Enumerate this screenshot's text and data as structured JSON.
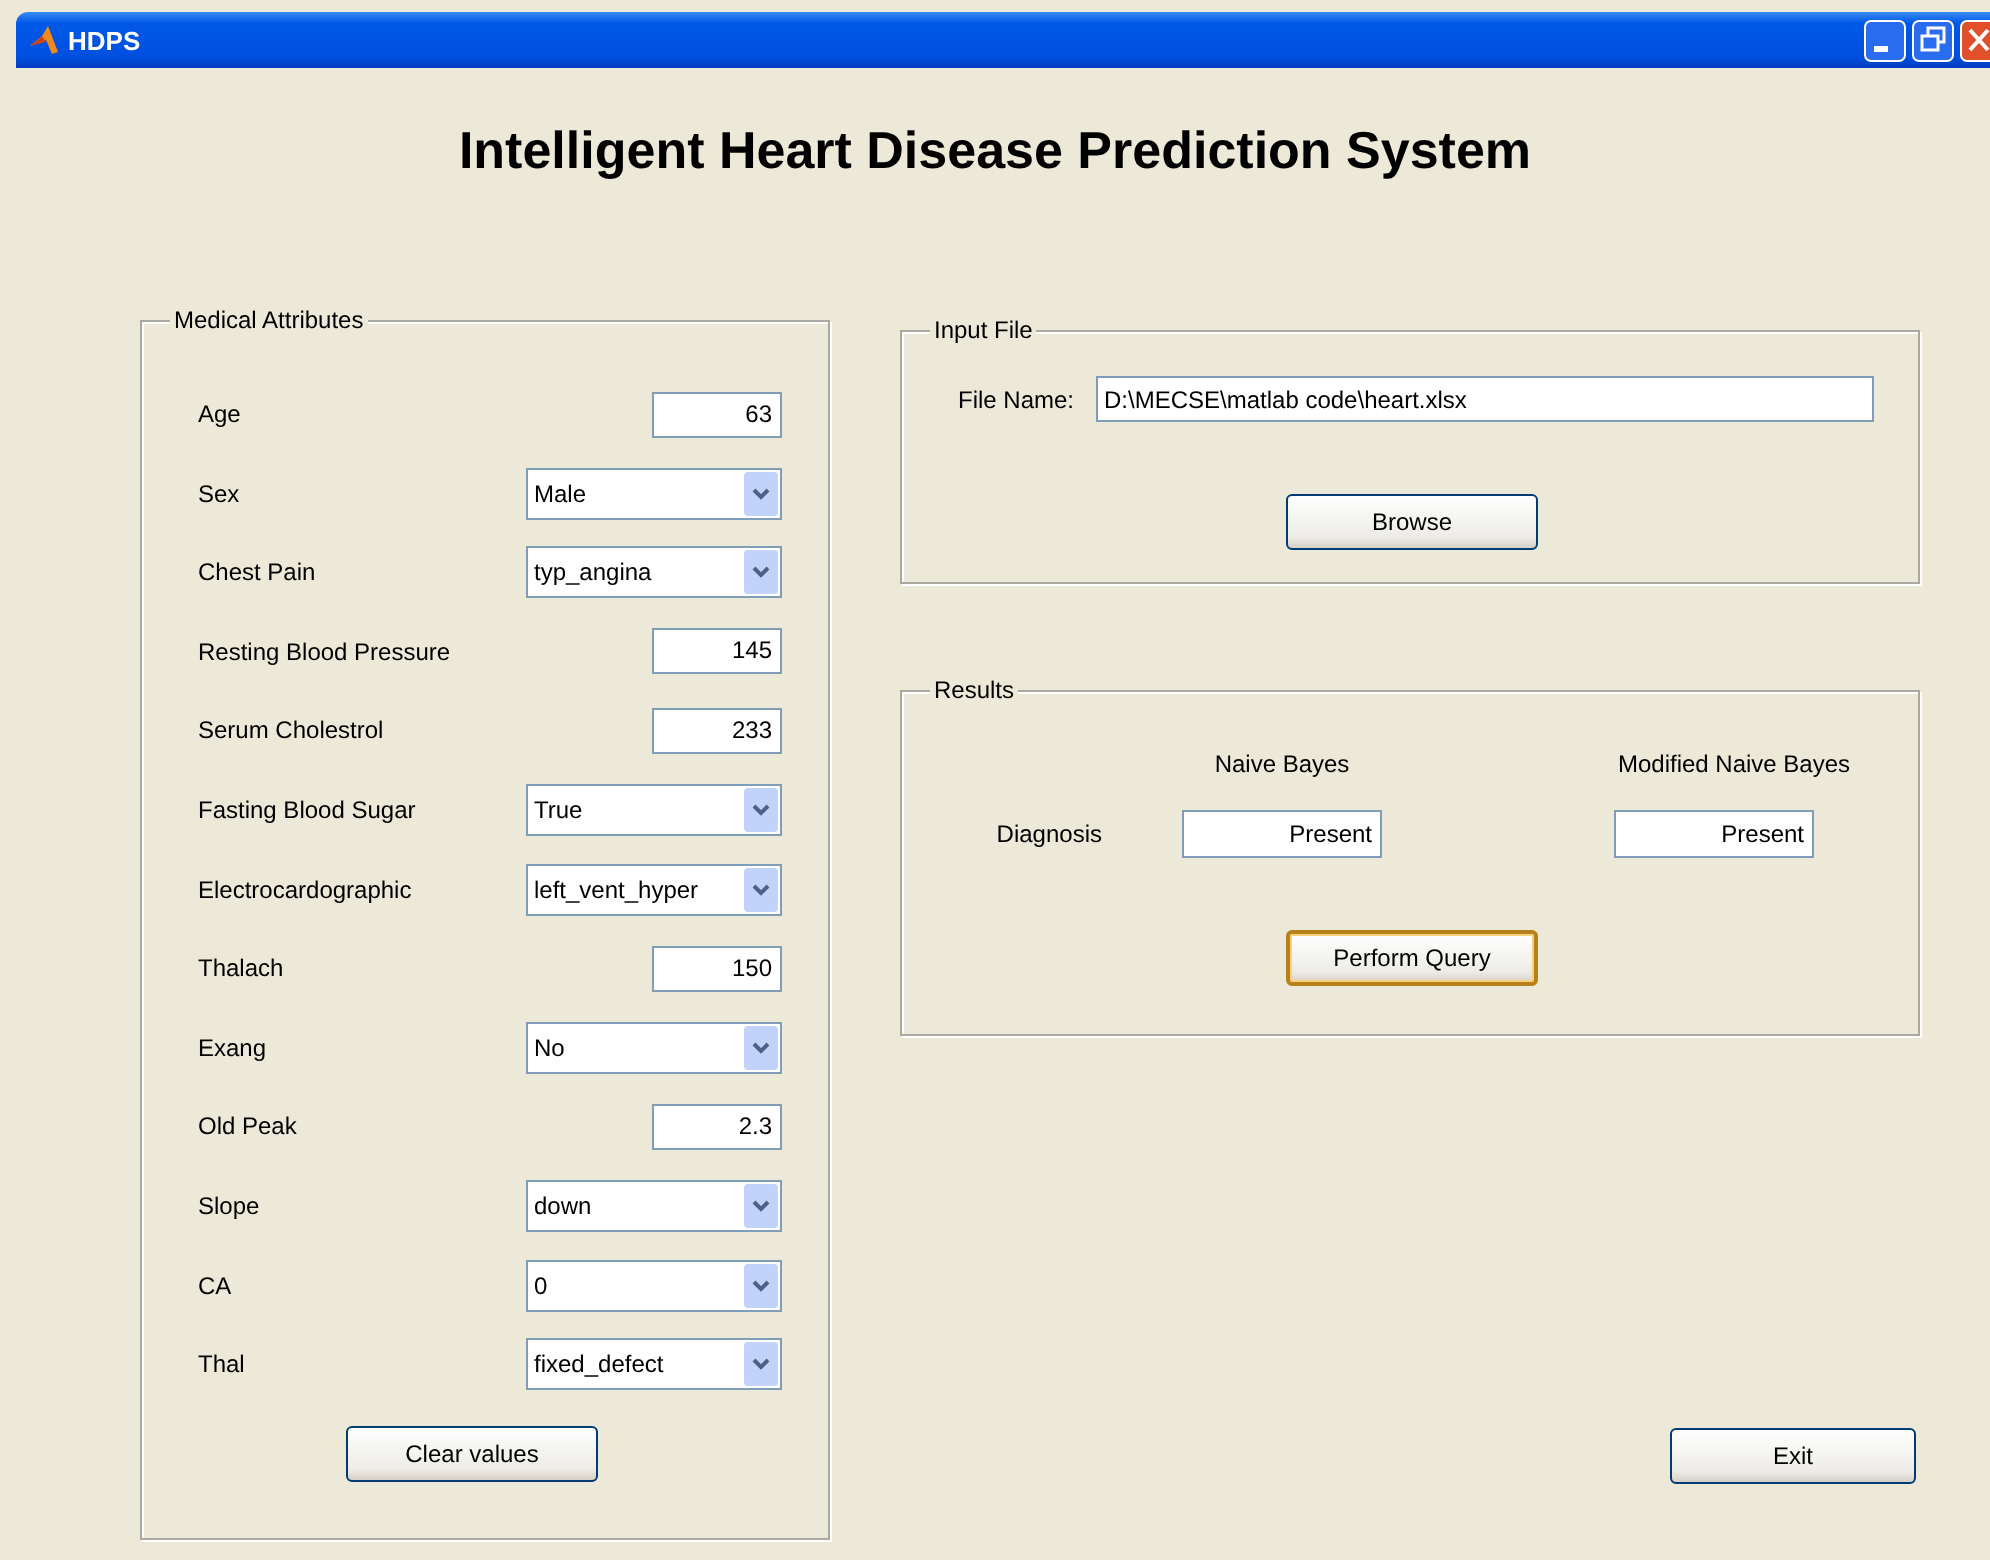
{
  "window": {
    "title": "HDPS"
  },
  "heading": "Intelligent Heart Disease Prediction System",
  "medical_attributes": {
    "legend": "Medical Attributes",
    "fields": [
      {
        "label": "Age",
        "kind": "text",
        "value": "63"
      },
      {
        "label": "Sex",
        "kind": "dropdown",
        "value": "Male"
      },
      {
        "label": "Chest Pain",
        "kind": "dropdown",
        "value": "typ_angina"
      },
      {
        "label": "Resting Blood Pressure",
        "kind": "text",
        "value": "145"
      },
      {
        "label": "Serum Cholestrol",
        "kind": "text",
        "value": "233"
      },
      {
        "label": "Fasting Blood Sugar",
        "kind": "dropdown",
        "value": "True"
      },
      {
        "label": "Electrocardographic",
        "kind": "dropdown",
        "value": "left_vent_hyper"
      },
      {
        "label": "Thalach",
        "kind": "text",
        "value": "150"
      },
      {
        "label": "Exang",
        "kind": "dropdown",
        "value": "No"
      },
      {
        "label": "Old Peak",
        "kind": "text",
        "value": "2.3"
      },
      {
        "label": "Slope",
        "kind": "dropdown",
        "value": "down"
      },
      {
        "label": "CA",
        "kind": "dropdown",
        "value": "0"
      },
      {
        "label": "Thal",
        "kind": "dropdown",
        "value": "fixed_defect"
      }
    ],
    "button": {
      "label": "Clear values",
      "focused": false
    }
  },
  "input_file": {
    "legend": "Input File",
    "file_name_label": "File Name:",
    "file_name": "D:\\MECSE\\matlab code\\heart.xlsx",
    "button": {
      "label": "Browse",
      "focused": false
    }
  },
  "results": {
    "legend": "Results",
    "columns": [
      "Naive Bayes",
      "Modified Naive Bayes"
    ],
    "row_label": "Diagnosis",
    "values": [
      "Present",
      "Present"
    ],
    "button": {
      "label": "Perform Query",
      "focused": true
    }
  },
  "exit_button": {
    "label": "Exit",
    "focused": false
  }
}
